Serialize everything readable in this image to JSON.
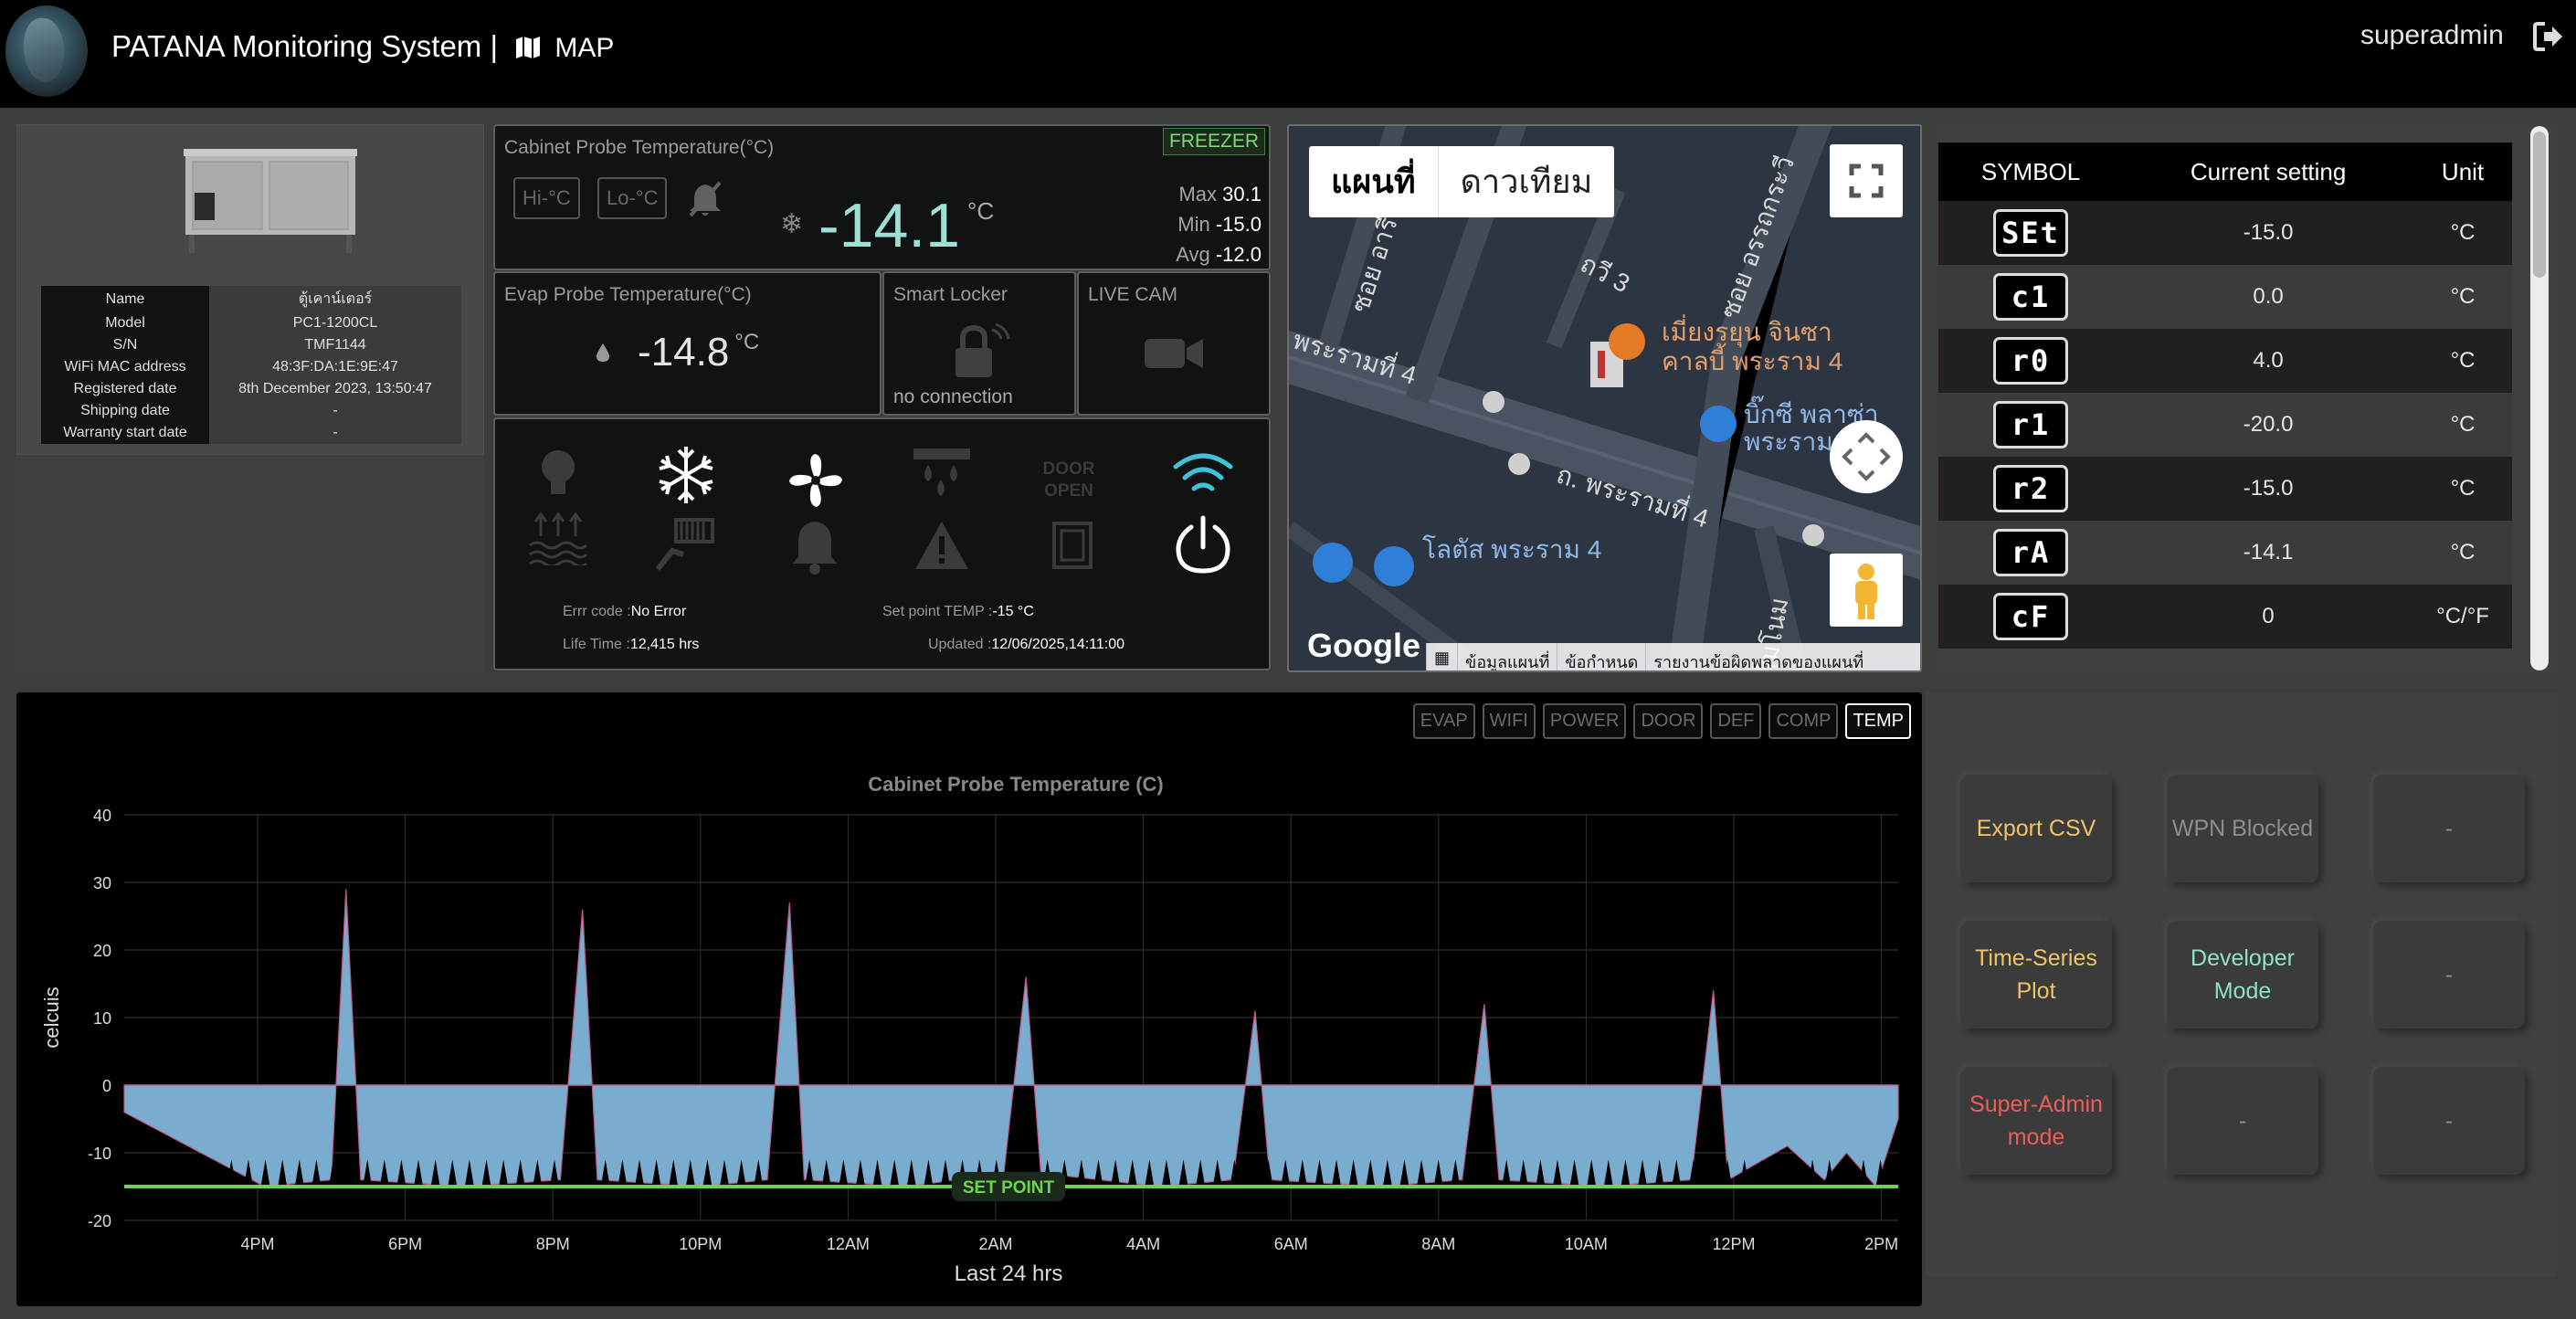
{
  "header": {
    "title": "PATANA Monitoring System |",
    "map_label": "MAP",
    "user": "superadmin"
  },
  "device": {
    "rows": [
      {
        "key": "Name",
        "value": "ตู้เคาน์เตอร์"
      },
      {
        "key": "Model",
        "value": "PC1-1200CL"
      },
      {
        "key": "S/N",
        "value": "TMF1144"
      },
      {
        "key": "WiFi MAC address",
        "value": "48:3F:DA:1E:9E:47"
      },
      {
        "key": "Registered date",
        "value": "8th December 2023, 13:50:47"
      },
      {
        "key": "Shipping date",
        "value": "-"
      },
      {
        "key": "Warranty start date",
        "value": "-"
      }
    ]
  },
  "cabinet": {
    "label": "Cabinet Probe Temperature(°C)",
    "mode": "FREEZER",
    "hi_label": "Hi-°C",
    "lo_label": "Lo-°C",
    "temp": "-14.1",
    "unit": "°C",
    "max_label": "Max",
    "max": "30.1",
    "min_label": "Min",
    "min": "-15.0",
    "avg_label": "Avg",
    "avg": "-12.0"
  },
  "evap": {
    "label": "Evap Probe Temperature(°C)",
    "temp": "-14.8",
    "unit": "°C"
  },
  "locker": {
    "label": "Smart Locker",
    "status": "no connection"
  },
  "cam": {
    "label": "LIVE CAM"
  },
  "status": {
    "error_label": "Errr code :",
    "error_value": "No Error",
    "setpoint_label": "Set point TEMP :",
    "setpoint_value": "-15 °C",
    "lifetime_label": "Life Time :",
    "lifetime_value": "12,415 hrs",
    "updated_label": "Updated :",
    "updated_value": "12/06/2025,14:11:00",
    "door_text": "DOOR OPEN"
  },
  "map": {
    "tab_map": "แผนที่",
    "tab_satellite": "ดาวเทียม",
    "google": "Google",
    "footer": [
      "ข้อมูลแผนที่",
      "ข้อกำหนด",
      "รายงานข้อผิดพลาดของแผนที่"
    ],
    "poi_restaurant": "เมี่ยงรยุน จินซา",
    "poi_restaurant2": "คาลบี้ พระราม 4",
    "poi_bigc": "บิ๊กซี พลาซ่า",
    "poi_bigc2": "พระราม",
    "poi_lotus": "โลตัส พระราม 4",
    "road1": "พระรามที่ 4",
    "road2": "ถ. พระรามที่ 4",
    "road3": "ซอย อรรถกระวี",
    "road4": "ถวี 3",
    "road5": "ซอย อารี",
    "road6": "สัมโนม"
  },
  "settings": {
    "headers": [
      "SYMBOL",
      "Current setting",
      "Unit"
    ],
    "rows": [
      {
        "symbol": "SEt",
        "value": "-15.0",
        "unit": "°C"
      },
      {
        "symbol": "c1",
        "value": "0.0",
        "unit": "°C"
      },
      {
        "symbol": "r0",
        "value": "4.0",
        "unit": "°C"
      },
      {
        "symbol": "r1",
        "value": "-20.0",
        "unit": "°C"
      },
      {
        "symbol": "r2",
        "value": "-15.0",
        "unit": "°C"
      },
      {
        "symbol": "rA",
        "value": "-14.1",
        "unit": "°C"
      },
      {
        "symbol": "cF",
        "value": "0",
        "unit": "°C/°F"
      }
    ]
  },
  "chart_tabs": [
    "EVAP",
    "WIFI",
    "POWER",
    "DOOR",
    "DEF",
    "COMP",
    "TEMP"
  ],
  "chart_data": {
    "type": "area",
    "title": "Cabinet Probe Temperature (C)",
    "xlabel": "Last 24 hrs",
    "ylabel": "celcuis",
    "ylim": [
      -20,
      40
    ],
    "yticks": [
      40,
      30,
      20,
      10,
      0,
      -10,
      -20
    ],
    "xticks": [
      "4PM",
      "6PM",
      "8PM",
      "10PM",
      "12AM",
      "2AM",
      "4AM",
      "6AM",
      "8AM",
      "10AM",
      "12PM",
      "2PM"
    ],
    "setpoint": -15,
    "setpoint_label": "SET POINT",
    "x_hours": [
      0,
      1.9,
      2.8,
      3.0,
      3.2,
      4.6,
      5.9,
      6.2,
      6.4,
      7.8,
      8.7,
      9.0,
      9.2,
      10.6,
      11.9,
      12.2,
      12.4,
      14.0,
      15.0,
      15.3,
      15.5,
      17.0,
      18.1,
      18.4,
      18.6,
      20.0,
      21.2,
      21.5,
      21.7,
      22.5,
      23.0,
      23.3,
      23.7,
      24.0
    ],
    "values": [
      -4,
      -15,
      -14,
      29,
      -14,
      -15,
      -14,
      26,
      -14,
      -15,
      -14,
      27,
      -14,
      -15,
      -13,
      16,
      -13,
      -15,
      -14,
      11,
      -14,
      -15,
      -14,
      12,
      -14,
      -15,
      -14,
      14,
      -14,
      -9,
      -14,
      -10,
      -15,
      -5
    ],
    "colors": {
      "fill": "#7aaccf",
      "setpoint": "#6bd64b",
      "accent": "#9de0d8"
    }
  },
  "actions": [
    {
      "label": "Export CSV",
      "color": "#f0c463"
    },
    {
      "label": "WPN Blocked",
      "color": "#8d8f8d"
    },
    {
      "label": "-",
      "color": "#8d8f8d"
    },
    {
      "label": "Time-Series Plot",
      "color": "#f0c463"
    },
    {
      "label": "Developer Mode",
      "color": "#8fe3c0"
    },
    {
      "label": "-",
      "color": "#8d8f8d"
    },
    {
      "label": "Super-Admin mode",
      "color": "#e8605a"
    },
    {
      "label": "-",
      "color": "#8d8f8d"
    },
    {
      "label": "-",
      "color": "#8d8f8d"
    }
  ]
}
